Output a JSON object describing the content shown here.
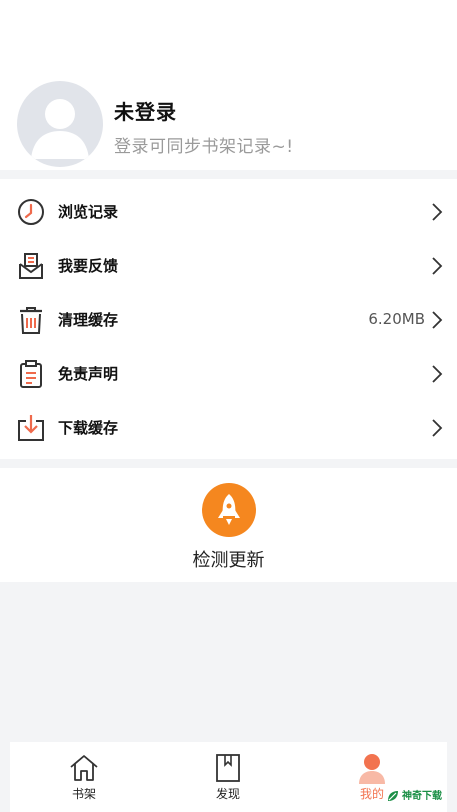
{
  "profile": {
    "name": "未登录",
    "subtitle": "登录可同步书架记录~!"
  },
  "menu": {
    "items": [
      {
        "label": "浏览记录",
        "icon": "clock-icon",
        "value": ""
      },
      {
        "label": "我要反馈",
        "icon": "feedback-envelope-icon",
        "value": ""
      },
      {
        "label": "清理缓存",
        "icon": "trash-icon",
        "value": "6.20MB"
      },
      {
        "label": "免责声明",
        "icon": "clipboard-icon",
        "value": ""
      },
      {
        "label": "下载缓存",
        "icon": "download-box-icon",
        "value": ""
      }
    ]
  },
  "update": {
    "label": "检测更新",
    "icon": "rocket-icon"
  },
  "tabbar": {
    "tabs": [
      {
        "label": "书架",
        "icon": "home-icon",
        "active": false
      },
      {
        "label": "发现",
        "icon": "book-icon",
        "active": false
      },
      {
        "label": "我的",
        "icon": "user-icon",
        "active": true
      }
    ]
  },
  "watermark": {
    "text": "神奇下载"
  },
  "colors": {
    "accent": "#f5871f",
    "menu_icon_orange": "#ef6a4c",
    "tab_active": "#f2734f",
    "background": "#f3f4f6"
  }
}
